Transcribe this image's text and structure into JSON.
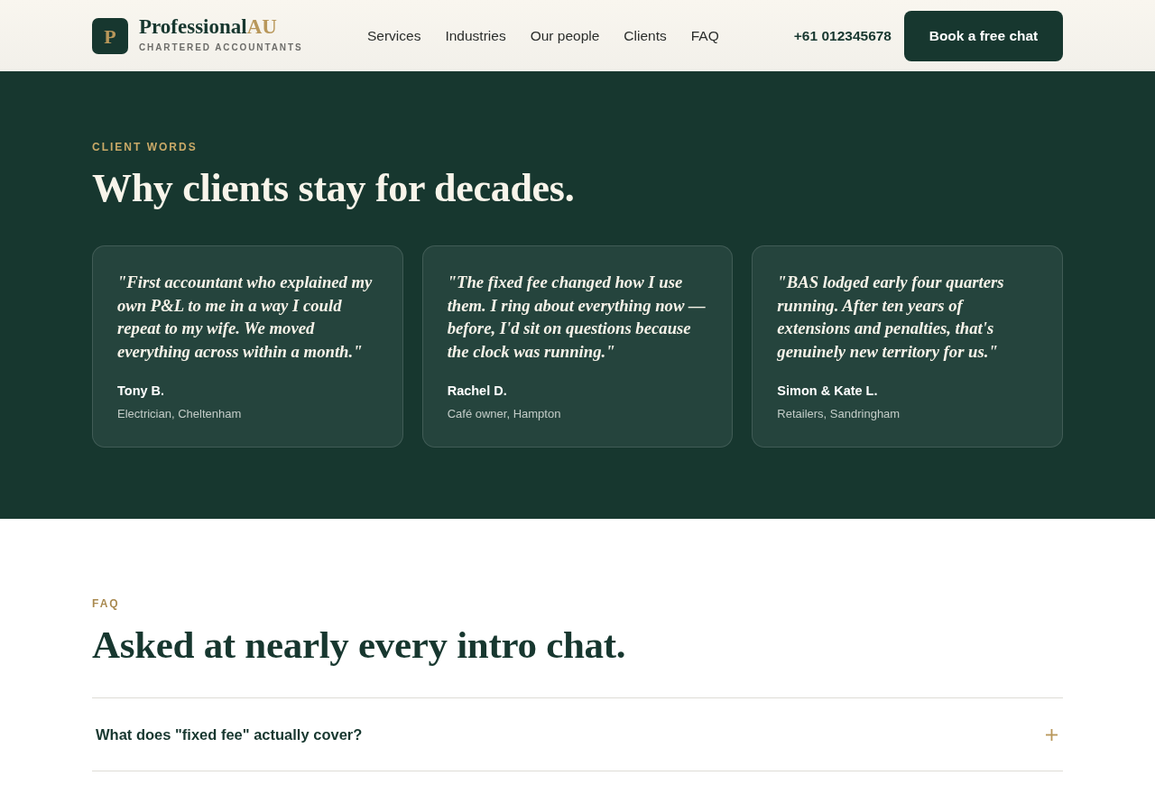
{
  "header": {
    "brand": {
      "mark": "P",
      "name": "Professional",
      "suffix": "AU",
      "tagline": "CHARTERED ACCOUNTANTS"
    },
    "nav": [
      {
        "label": "Services"
      },
      {
        "label": "Industries"
      },
      {
        "label": "Our people"
      },
      {
        "label": "Clients"
      },
      {
        "label": "FAQ"
      }
    ],
    "phone": "+61 012345678",
    "cta": "Book a free chat"
  },
  "testimonials": {
    "eyebrow": "CLIENT WORDS",
    "title": "Why clients stay for decades.",
    "cards": [
      {
        "quote": "\"First accountant who explained my own P&L to me in a way I could repeat to my wife. We moved everything across within a month.\"",
        "name": "Tony B.",
        "role": "Electrician, Cheltenham"
      },
      {
        "quote": "\"The fixed fee changed how I use them. I ring about everything now — before, I'd sit on questions because the clock was running.\"",
        "name": "Rachel D.",
        "role": "Café owner, Hampton"
      },
      {
        "quote": "\"BAS lodged early four quarters running. After ten years of extensions and penalties, that's genuinely new territory for us.\"",
        "name": "Simon & Kate L.",
        "role": "Retailers, Sandringham"
      }
    ]
  },
  "faq": {
    "eyebrow": "FAQ",
    "title": "Asked at nearly every intro chat.",
    "items": [
      {
        "question": "What does \"fixed fee\" actually cover?",
        "expanded": false
      }
    ]
  }
}
